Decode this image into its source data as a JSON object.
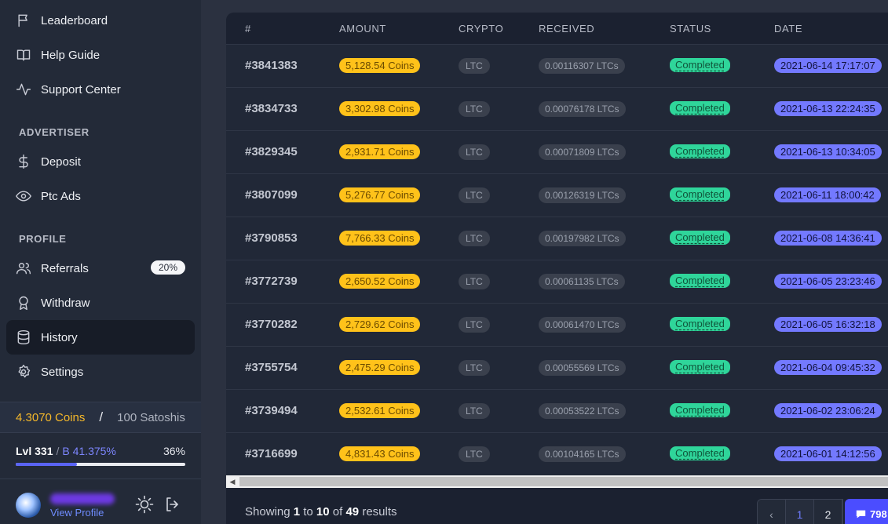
{
  "sidebar": {
    "items_top": [
      {
        "label": "Leaderboard",
        "icon": "flag-icon"
      },
      {
        "label": "Help Guide",
        "icon": "book-icon"
      },
      {
        "label": "Support Center",
        "icon": "activity-icon"
      }
    ],
    "advertiser_title": "ADVERTISER",
    "advertiser_items": [
      {
        "label": "Deposit",
        "icon": "dollar-icon"
      },
      {
        "label": "Ptc Ads",
        "icon": "eye-icon"
      }
    ],
    "profile_title": "PROFILE",
    "profile_items": [
      {
        "label": "Referrals",
        "icon": "users-icon",
        "badge": "20%"
      },
      {
        "label": "Withdraw",
        "icon": "award-icon"
      },
      {
        "label": "History",
        "icon": "database-icon",
        "active": true
      },
      {
        "label": "Settings",
        "icon": "gear-icon"
      }
    ]
  },
  "balance": {
    "coins": "4.3070 Coins",
    "separator": "/",
    "satoshis": "100 Satoshis"
  },
  "level": {
    "lvl": "Lvl 331",
    "sep": "/",
    "boost": "B 41.375%",
    "percent": "36%",
    "progress_fraction": 0.36
  },
  "profile": {
    "view_profile": "View Profile"
  },
  "table": {
    "headers": [
      "#",
      "AMOUNT",
      "CRYPTO",
      "RECEIVED",
      "STATUS",
      "DATE"
    ],
    "rows": [
      {
        "id": "#3841383",
        "amount": "5,128.54 Coins",
        "crypto": "LTC",
        "received": "0.00116307 LTCs",
        "status": "Completed",
        "date": "2021-06-14 17:17:07"
      },
      {
        "id": "#3834733",
        "amount": "3,302.98 Coins",
        "crypto": "LTC",
        "received": "0.00076178 LTCs",
        "status": "Completed",
        "date": "2021-06-13 22:24:35"
      },
      {
        "id": "#3829345",
        "amount": "2,931.71 Coins",
        "crypto": "LTC",
        "received": "0.00071809 LTCs",
        "status": "Completed",
        "date": "2021-06-13 10:34:05"
      },
      {
        "id": "#3807099",
        "amount": "5,276.77 Coins",
        "crypto": "LTC",
        "received": "0.00126319 LTCs",
        "status": "Completed",
        "date": "2021-06-11 18:00:42"
      },
      {
        "id": "#3790853",
        "amount": "7,766.33 Coins",
        "crypto": "LTC",
        "received": "0.00197982 LTCs",
        "status": "Completed",
        "date": "2021-06-08 14:36:41"
      },
      {
        "id": "#3772739",
        "amount": "2,650.52 Coins",
        "crypto": "LTC",
        "received": "0.00061135 LTCs",
        "status": "Completed",
        "date": "2021-06-05 23:23:46"
      },
      {
        "id": "#3770282",
        "amount": "2,729.62 Coins",
        "crypto": "LTC",
        "received": "0.00061470 LTCs",
        "status": "Completed",
        "date": "2021-06-05 16:32:18"
      },
      {
        "id": "#3755754",
        "amount": "2,475.29 Coins",
        "crypto": "LTC",
        "received": "0.00055569 LTCs",
        "status": "Completed",
        "date": "2021-06-04 09:45:32"
      },
      {
        "id": "#3739494",
        "amount": "2,532.61 Coins",
        "crypto": "LTC",
        "received": "0.00053522 LTCs",
        "status": "Completed",
        "date": "2021-06-02 23:06:24"
      },
      {
        "id": "#3716699",
        "amount": "4,831.43 Coins",
        "crypto": "LTC",
        "received": "0.00104165 LTCs",
        "status": "Completed",
        "date": "2021-06-01 14:12:56"
      }
    ]
  },
  "footer": {
    "showing_prefix": "Showing",
    "from": "1",
    "to_word": "to",
    "to": "10",
    "of_word": "of",
    "total": "49",
    "results_word": "results",
    "prev_label": "‹",
    "pages": [
      "1",
      "2"
    ],
    "chat_count": "798"
  },
  "colors": {
    "accent": "#5a64f5",
    "amount_badge": "#ffc21a",
    "status_badge": "#2fd59a",
    "date_badge": "#7379ff",
    "coins_text": "#f5b82a"
  }
}
